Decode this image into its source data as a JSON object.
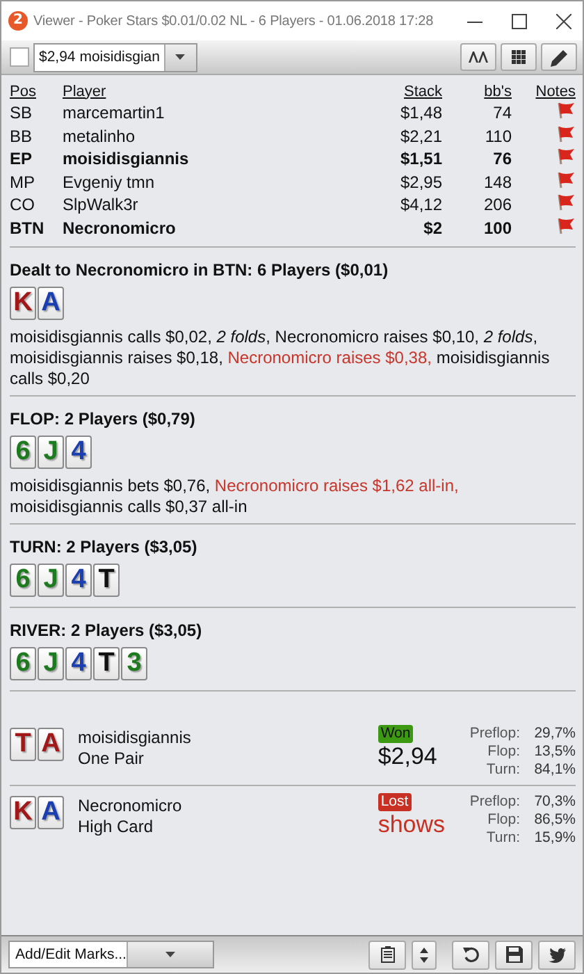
{
  "window": {
    "badge": "2",
    "title": "Viewer - Poker Stars $0.01/0.02 NL - 6 Players - 01.06.2018 17:28"
  },
  "toolbar": {
    "checked": false,
    "hand_select": "$2,94 moisidisgian"
  },
  "players": {
    "columns": [
      "Pos",
      "Player",
      "Stack",
      "bb's",
      "Notes"
    ],
    "rows": [
      {
        "pos": "SB",
        "name": "marcemartin1",
        "stack": "$1,48",
        "bbs": "74",
        "bold": false
      },
      {
        "pos": "BB",
        "name": "metalinho",
        "stack": "$2,21",
        "bbs": "110",
        "bold": false
      },
      {
        "pos": "EP",
        "name": "moisidisgiannis",
        "stack": "$1,51",
        "bbs": "76",
        "bold": true
      },
      {
        "pos": "MP",
        "name": "Evgeniy tmn",
        "stack": "$2,95",
        "bbs": "148",
        "bold": false
      },
      {
        "pos": "CO",
        "name": "SlpWalk3r",
        "stack": "$4,12",
        "bbs": "206",
        "bold": false
      },
      {
        "pos": "BTN",
        "name": "Necronomicro",
        "stack": "$2",
        "bbs": "100",
        "bold": true
      }
    ]
  },
  "streets": [
    {
      "title": "Dealt to Necronomicro in BTN: 6 Players ($0,01)",
      "cards": [
        {
          "rank": "K",
          "color": "#a01818"
        },
        {
          "rank": "A",
          "color": "#1a3fb0"
        }
      ],
      "actions": [
        {
          "text": "moisidisgiannis calls $0,02, ",
          "kind": "plain"
        },
        {
          "text": "2 folds",
          "kind": "fold"
        },
        {
          "text": ", Necronomicro raises $0,10, ",
          "kind": "plain"
        },
        {
          "text": "2 folds",
          "kind": "fold"
        },
        {
          "text": ", moisidisgiannis raises $0,18, ",
          "kind": "plain"
        },
        {
          "text": "Necronomicro raises $0,38,",
          "kind": "hero"
        },
        {
          "text": " moisidisgiannis calls $0,20",
          "kind": "plain"
        }
      ]
    },
    {
      "title": "FLOP: 2 Players ($0,79)",
      "cards": [
        {
          "rank": "6",
          "color": "#1e7a1e"
        },
        {
          "rank": "J",
          "color": "#1e7a1e"
        },
        {
          "rank": "4",
          "color": "#1a3fb0"
        }
      ],
      "actions": [
        {
          "text": "moisidisgiannis bets $0,76, ",
          "kind": "plain"
        },
        {
          "text": "Necronomicro raises $1,62 all-in,",
          "kind": "hero"
        },
        {
          "text": " moisidisgiannis calls $0,37 all-in",
          "kind": "plain"
        }
      ]
    },
    {
      "title": "TURN: 2 Players ($3,05)",
      "cards": [
        {
          "rank": "6",
          "color": "#1e7a1e"
        },
        {
          "rank": "J",
          "color": "#1e7a1e"
        },
        {
          "rank": "4",
          "color": "#1a3fb0"
        },
        {
          "rank": "T",
          "color": "#111111"
        }
      ]
    },
    {
      "title": "RIVER: 2 Players ($3,05)",
      "cards": [
        {
          "rank": "6",
          "color": "#1e7a1e"
        },
        {
          "rank": "J",
          "color": "#1e7a1e"
        },
        {
          "rank": "4",
          "color": "#1a3fb0"
        },
        {
          "rank": "T",
          "color": "#111111"
        },
        {
          "rank": "3",
          "color": "#1e7a1e"
        }
      ]
    }
  ],
  "results": [
    {
      "cards": [
        {
          "rank": "T",
          "color": "#a01818"
        },
        {
          "rank": "A",
          "color": "#a01818"
        }
      ],
      "name": "moisidisgiannis",
      "hand": "One Pair",
      "outcome": {
        "label": "Won",
        "kind": "won"
      },
      "amount": "$2,94",
      "equity": [
        {
          "label": "Preflop:",
          "value": "29,7%"
        },
        {
          "label": "Flop:",
          "value": "13,5%"
        },
        {
          "label": "Turn:",
          "value": "84,1%"
        }
      ]
    },
    {
      "cards": [
        {
          "rank": "K",
          "color": "#a01818"
        },
        {
          "rank": "A",
          "color": "#1a3fb0"
        }
      ],
      "name": "Necronomicro",
      "hand": "High Card",
      "outcome": {
        "label": "Lost",
        "kind": "lost"
      },
      "amount": "shows",
      "equity": [
        {
          "label": "Preflop:",
          "value": "70,3%"
        },
        {
          "label": "Flop:",
          "value": "86,5%"
        },
        {
          "label": "Turn:",
          "value": "15,9%"
        }
      ]
    }
  ],
  "bottom": {
    "marks": "Add/Edit Marks..."
  }
}
